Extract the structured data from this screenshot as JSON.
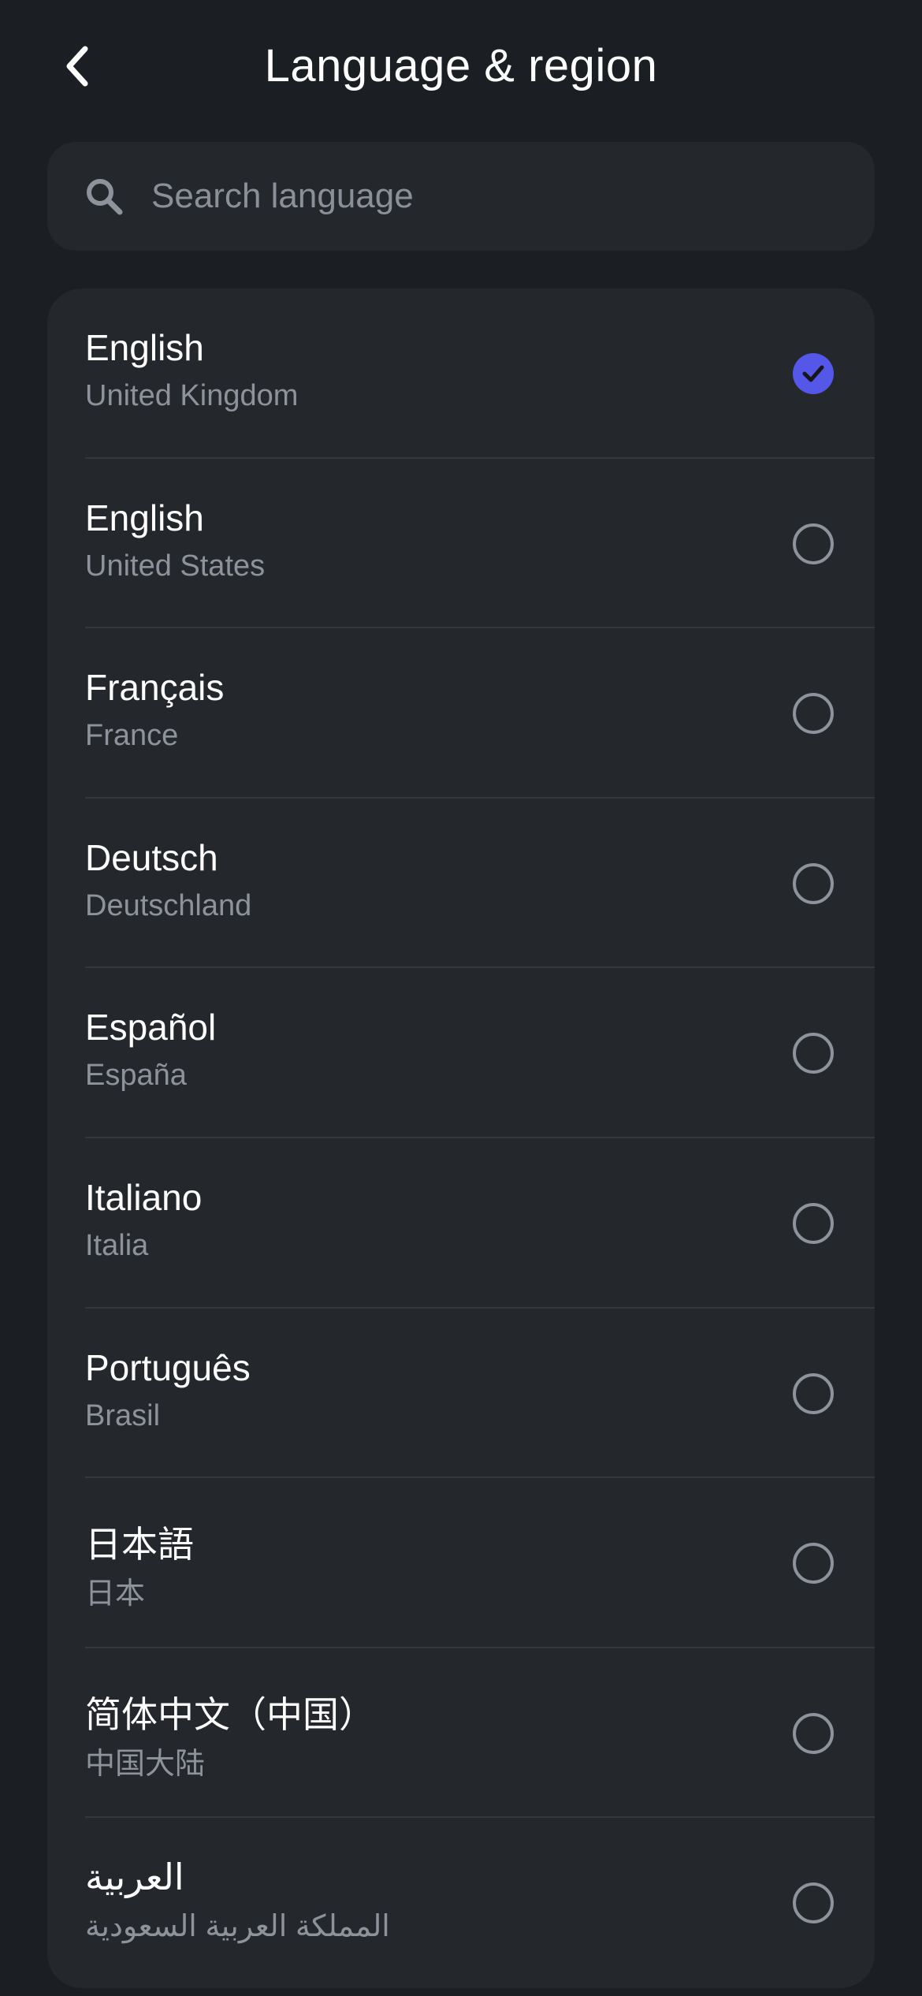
{
  "header": {
    "title": "Language & region",
    "back_icon": "chevron-left-icon"
  },
  "search": {
    "placeholder": "Search language",
    "value": "",
    "icon": "search-icon"
  },
  "colors": {
    "background": "#1b1e22",
    "card": "#24272c",
    "accent": "#5457e8",
    "secondary_text": "#8e939b"
  },
  "languages": [
    {
      "name": "English",
      "region": "United Kingdom",
      "selected": true
    },
    {
      "name": "English",
      "region": "United States",
      "selected": false
    },
    {
      "name": "Français",
      "region": "France",
      "selected": false
    },
    {
      "name": "Deutsch",
      "region": "Deutschland",
      "selected": false
    },
    {
      "name": "Español",
      "region": "España",
      "selected": false
    },
    {
      "name": "Italiano",
      "region": "Italia",
      "selected": false
    },
    {
      "name": "Português",
      "region": "Brasil",
      "selected": false
    },
    {
      "name": "日本語",
      "region": "日本",
      "selected": false
    },
    {
      "name": "简体中文（中国）",
      "region": "中国大陆",
      "selected": false
    },
    {
      "name": "العربية",
      "region": "المملكة العربية السعودية",
      "selected": false
    }
  ]
}
